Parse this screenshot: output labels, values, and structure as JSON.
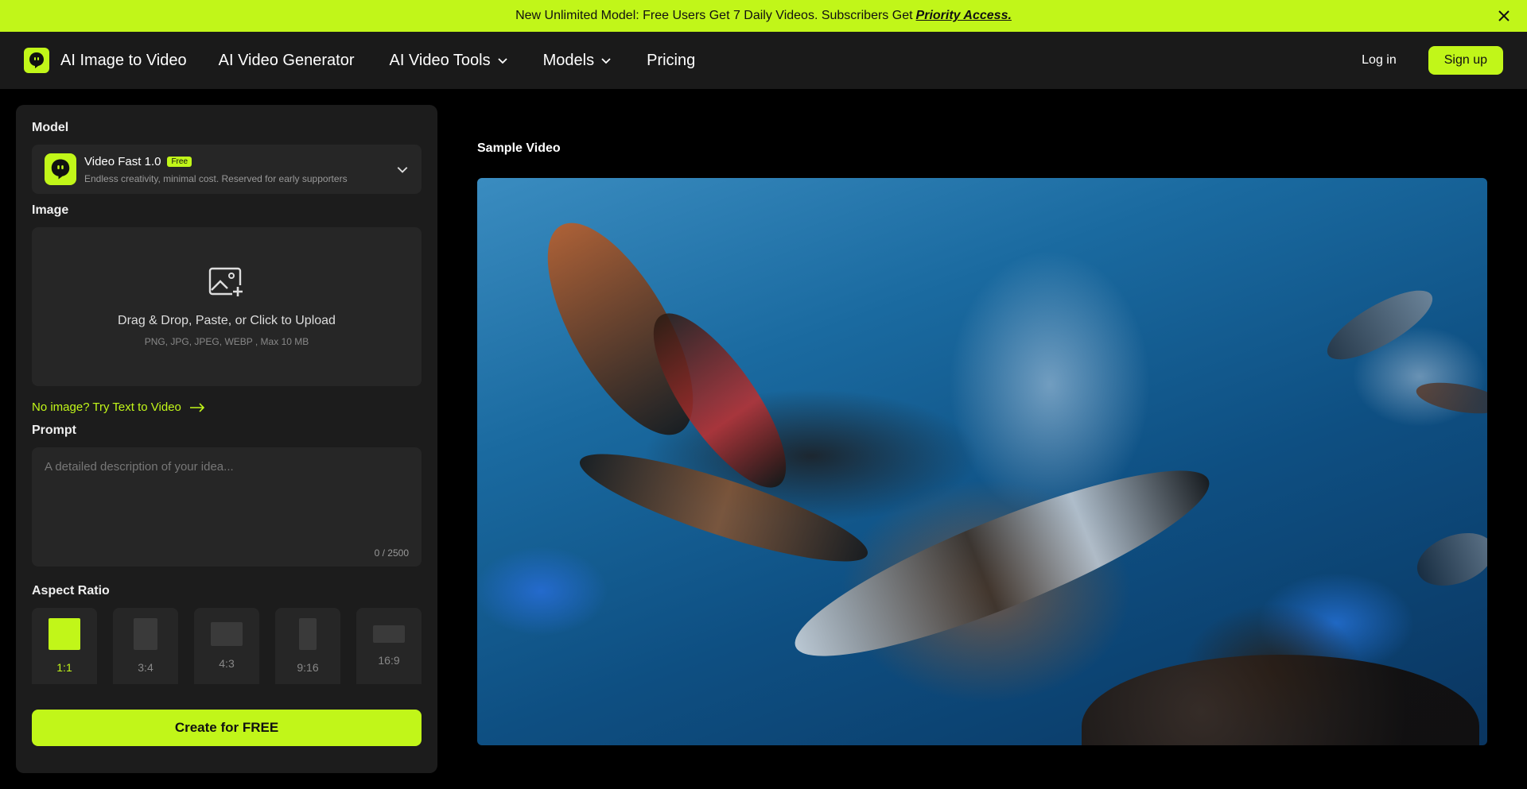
{
  "announcement": {
    "text": "New Unlimited Model: Free Users Get 7 Daily Videos. Subscribers Get",
    "link": "Priority Access."
  },
  "nav": {
    "brand": "AI Image to Video",
    "items": [
      {
        "label": "AI Video Generator"
      },
      {
        "label": "AI Video Tools"
      },
      {
        "label": "Models"
      },
      {
        "label": "Pricing"
      }
    ],
    "login": "Log in",
    "signup": "Sign up"
  },
  "panel": {
    "model_label": "Model",
    "model": {
      "name": "Video Fast 1.0",
      "badge": "Free",
      "description": "Endless creativity, minimal cost. Reserved for early supporters"
    },
    "image_label": "Image",
    "upload": {
      "title": "Drag & Drop, Paste, or Click to Upload",
      "formats": "PNG, JPG, JPEG, WEBP , Max 10 MB"
    },
    "try_link": "No image? Try Text to Video",
    "prompt_label": "Prompt",
    "prompt": {
      "placeholder": "A detailed description of your idea...",
      "value": "",
      "counter": "0 / 2500"
    },
    "aspect_label": "Aspect Ratio",
    "aspect_ratios": [
      {
        "label": "1:1",
        "active": true
      },
      {
        "label": "3:4",
        "active": false
      },
      {
        "label": "4:3",
        "active": false
      },
      {
        "label": "9:16",
        "active": false
      },
      {
        "label": "16:9",
        "active": false
      }
    ],
    "create_button": "Create for FREE"
  },
  "sample": {
    "label": "Sample Video"
  },
  "colors": {
    "accent": "#c1f619",
    "panel_bg": "#1c1c1c",
    "field_bg": "#262626"
  }
}
